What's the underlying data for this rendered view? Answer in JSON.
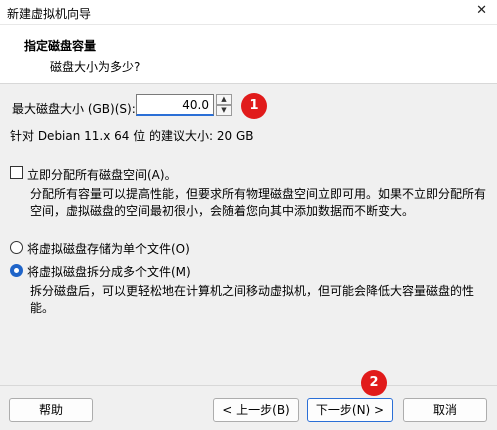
{
  "window": {
    "title": "新建虚拟机向导",
    "close_glyph": "✕"
  },
  "header": {
    "title": "指定磁盘容量",
    "subtitle": "磁盘大小为多少?"
  },
  "disk_size": {
    "label": "最大磁盘大小 (GB)(S):",
    "value": "40.0",
    "spin_up": "▲",
    "spin_down": "▼",
    "recommendation": "针对 Debian 11.x 64 位 的建议大小: 20 GB"
  },
  "allocate_now": {
    "label": "立即分配所有磁盘空间(A)。",
    "checked": false,
    "description_line1": "分配所有容量可以提高性能，但要求所有物理磁盘空间立即可用。如果不立即分配所有",
    "description_line2": "空间，虚拟磁盘的空间最初很小，会随着您向其中添加数据而不断变大。"
  },
  "storage_options": {
    "single_file_label": "将虚拟磁盘存储为单个文件(O)",
    "multi_file_label": "将虚拟磁盘拆分成多个文件(M)",
    "selected": "multi_file",
    "multi_description_line1": "拆分磁盘后，可以更轻松地在计算机之间移动虚拟机，但可能会降低大容量磁盘的性",
    "multi_description_line2": "能。"
  },
  "annotations": {
    "badge_1": "1",
    "badge_2": "2",
    "badge_color": "#e11b1b"
  },
  "buttons": {
    "help": "帮助",
    "back": "< 上一步(B)",
    "next": "下一步(N) >",
    "cancel": "取消"
  },
  "colors": {
    "accent": "#1f64c8",
    "focus_border": "#2b6fd6"
  }
}
